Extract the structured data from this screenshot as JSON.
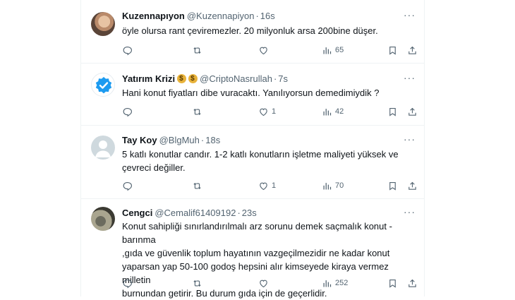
{
  "tweets": [
    {
      "name": "Kuzennapıyon",
      "handle": "@Kuzennapiyon",
      "sep": "·",
      "time": "16s",
      "text": "öyle olursa rant çeviremezler. 20 milyonluk arsa 200bine düşer.",
      "likes": "",
      "views": "65",
      "avatar": "photo-avatar"
    },
    {
      "name": "Yatırım Krizi",
      "emoji": [
        "money-bag",
        "money-bag"
      ],
      "handle": "@CriptoNasrullah",
      "sep": "·",
      "time": "7s",
      "text": "Hani konut fiyatları dibe vuracaktı. Yanılıyorsun demedimiydik ?",
      "likes": "1",
      "views": "42",
      "avatar": "verified-badge-avatar"
    },
    {
      "name": "Tay Koy",
      "handle": "@BlgMuh",
      "sep": "·",
      "time": "18s",
      "text_lines": [
        "5 katlı konutlar candır. 1-2 katlı konutların işletme maliyeti yüksek ve",
        "çevreci değiller."
      ],
      "likes": "1",
      "views": "70",
      "avatar": "default-avatar"
    },
    {
      "name": "Cengci",
      "handle": "@Cemalif61409192",
      "sep": "·",
      "time": "23s",
      "text_lines": [
        "Konut sahipliği sınırlandırılmalı arz sorunu demek saçmalık konut -barınma",
        ",gıda ve güvenlik toplum hayatının vazgeçilmezidir ne kadar konut",
        "yaparsan yap 50-100 godoş hepsini alır kimseyede kiraya vermez milletin",
        "burnundan getirir. Bu durum gıda için de geçerlidir."
      ],
      "likes": "",
      "views": "252",
      "avatar": "photo-avatar"
    }
  ],
  "more_icon": "···",
  "colors": {
    "text": "#0f1419",
    "muted": "#536471",
    "border": "#eff3f4",
    "verified": "#1d9bf0"
  }
}
